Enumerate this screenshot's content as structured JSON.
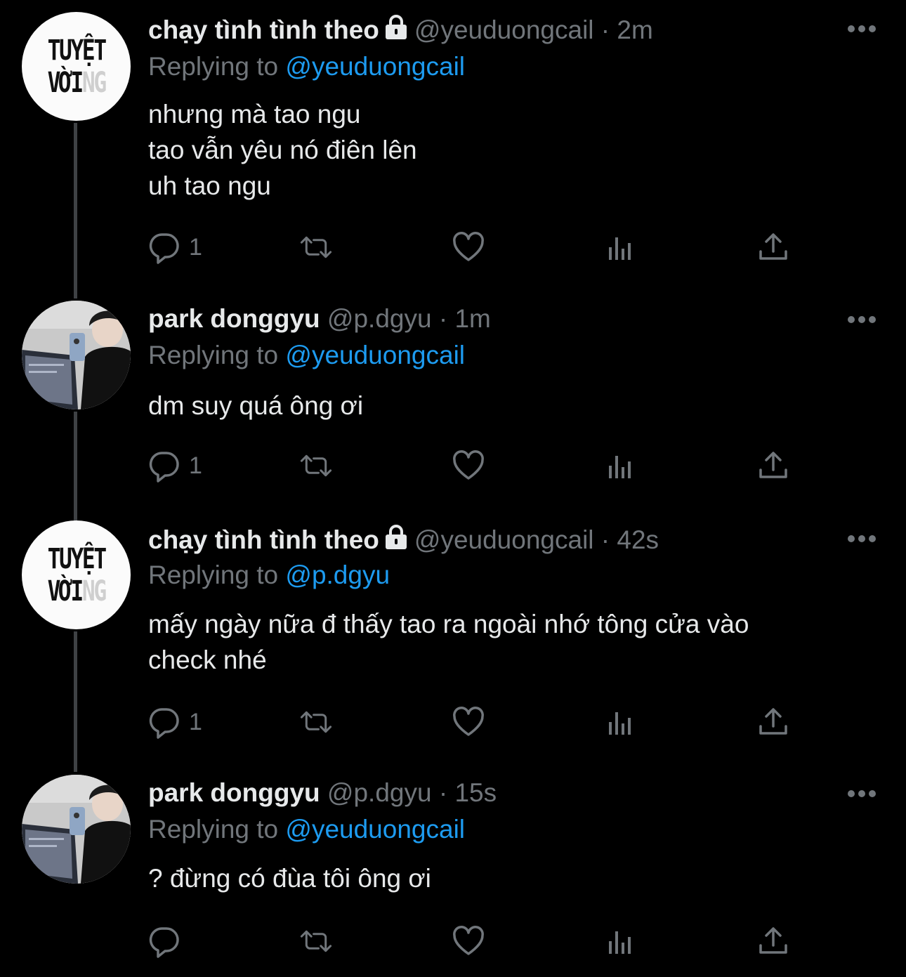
{
  "colors": {
    "background": "#000000",
    "text": "#e7e9ea",
    "muted": "#71767b",
    "accent": "#1d9bf0",
    "thread_line": "#3e4144"
  },
  "tweets": [
    {
      "name": "chạy tình tình theo",
      "locked": true,
      "handle": "@yeuduongcail",
      "separator": "·",
      "time": "2m",
      "replying_label": "Replying to",
      "replying_to": "@yeuduongcail",
      "text": "nhưng mà tao ngu\ntao vẫn yêu nó điên lên\nuh tao ngu",
      "reply_count": "1",
      "avatar": {
        "type": "text",
        "line1": "TUYỆT",
        "line2": "VỜI",
        "line2_faded": "NG"
      }
    },
    {
      "name": "park donggyu",
      "locked": false,
      "handle": "@p.dgyu",
      "separator": "·",
      "time": "1m",
      "replying_label": "Replying to",
      "replying_to": "@yeuduongcail",
      "text": "dm suy quá ông ơi",
      "reply_count": "1",
      "avatar": {
        "type": "photo"
      }
    },
    {
      "name": "chạy tình tình theo",
      "locked": true,
      "handle": "@yeuduongcail",
      "separator": "·",
      "time": "42s",
      "replying_label": "Replying to",
      "replying_to": "@p.dgyu",
      "text": "mấy ngày nữa đ thấy tao ra ngoài nhớ tông cửa vào\ncheck nhé",
      "reply_count": "1",
      "avatar": {
        "type": "text",
        "line1": "TUYỆT",
        "line2": "VỜI",
        "line2_faded": "NG"
      }
    },
    {
      "name": "park donggyu",
      "locked": false,
      "handle": "@p.dgyu",
      "separator": "·",
      "time": "15s",
      "replying_label": "Replying to",
      "replying_to": "@yeuduongcail",
      "text": "? đừng có đùa tôi ông ơi",
      "reply_count": "",
      "avatar": {
        "type": "photo"
      }
    }
  ],
  "icons": [
    "reply-icon",
    "retweet-icon",
    "like-icon",
    "views-icon",
    "share-icon",
    "more-icon",
    "lock-icon"
  ]
}
